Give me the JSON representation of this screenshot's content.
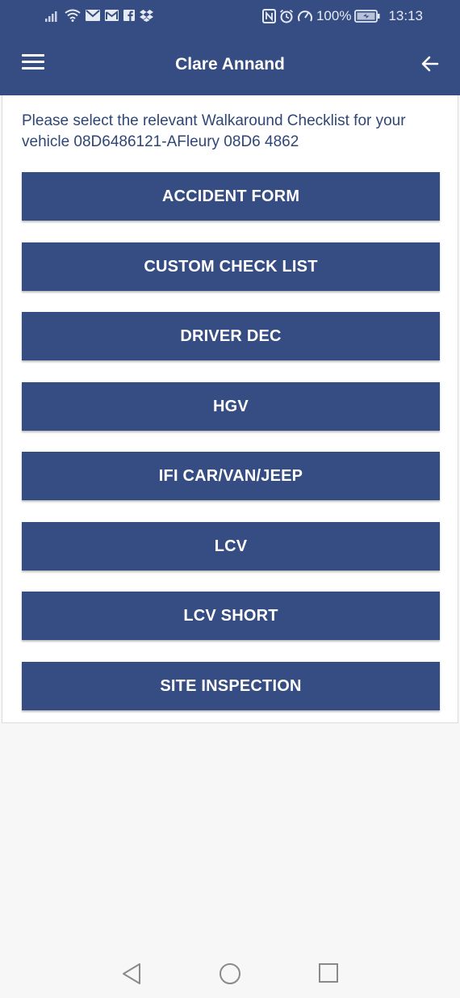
{
  "status_bar": {
    "icons": [
      "signal-icon",
      "wifi-icon",
      "mail-icon",
      "gmail-icon",
      "facebook-icon",
      "dropbox-icon"
    ],
    "right_icons": [
      "nfc-icon",
      "alarm-icon",
      "data-saver-icon"
    ],
    "battery": "100%",
    "time": "13:13"
  },
  "header": {
    "title": "Clare Annand",
    "menu_icon": "hamburger-menu-icon",
    "back_icon": "arrow-left-icon"
  },
  "main": {
    "prompt": "Please select the relevant Walkaround Checklist for your vehicle 08D6486121-AFleury 08D6 4862",
    "checklists": [
      "ACCIDENT FORM",
      "CUSTOM CHECK LIST",
      "DRIVER DEC",
      "HGV",
      "IFI CAR/VAN/JEEP",
      "LCV",
      "LCV SHORT",
      "SITE INSPECTION"
    ]
  },
  "nav_bar": {
    "buttons": [
      "back-triangle-icon",
      "home-circle-icon",
      "recents-square-icon"
    ]
  },
  "colors": {
    "primary": "#354d82",
    "background": "#f7f7f7",
    "card": "#ffffff",
    "prompt_text": "#2f4676"
  }
}
